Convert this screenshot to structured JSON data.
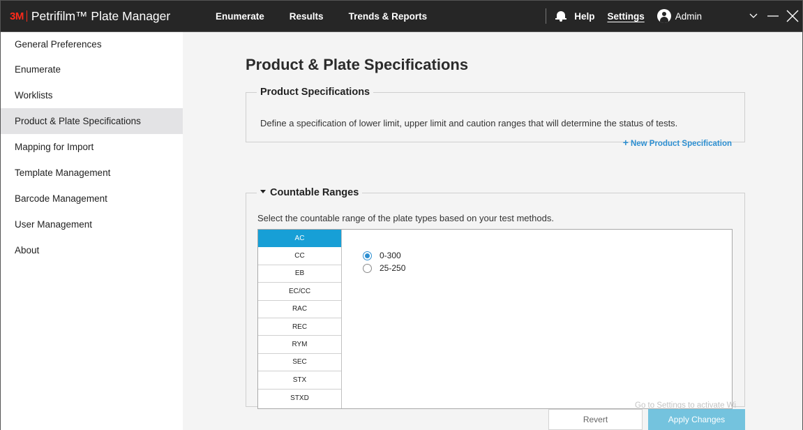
{
  "topbar": {
    "logo": "3M",
    "app_title": "Petrifilm™ Plate Manager",
    "nav": [
      "Enumerate",
      "Results",
      "Trends & Reports"
    ],
    "help": "Help",
    "settings": "Settings",
    "user": "Admin",
    "icons": [
      "bell-icon",
      "avatar-icon",
      "chevron-down-icon",
      "minimize-icon",
      "close-icon"
    ]
  },
  "sidebar": {
    "items": [
      {
        "label": "General Preferences"
      },
      {
        "label": "Enumerate"
      },
      {
        "label": "Worklists"
      },
      {
        "label": "Product & Plate Specifications",
        "active": true
      },
      {
        "label": "Mapping for Import"
      },
      {
        "label": "Template Management"
      },
      {
        "label": "Barcode Management"
      },
      {
        "label": "User Management"
      },
      {
        "label": "About"
      }
    ]
  },
  "main": {
    "title": "Product & Plate Specifications",
    "product_specs": {
      "legend": "Product Specifications",
      "description": "Define a specification of lower limit, upper limit and caution ranges that will determine the status of tests.",
      "new_link": "New Product Specification"
    },
    "countable_ranges": {
      "legend": "Countable Ranges",
      "description": "Select the countable range of the plate types based on your test methods.",
      "plate_types": [
        "AC",
        "CC",
        "EB",
        "EC/CC",
        "RAC",
        "REC",
        "RYM",
        "SEC",
        "STX",
        "STXD"
      ],
      "selected_plate": "AC",
      "ranges": [
        {
          "label": "0-300",
          "checked": true
        },
        {
          "label": "25-250",
          "checked": false
        }
      ]
    },
    "watermark": "Go to Settings to activate Wi",
    "buttons": {
      "revert": "Revert",
      "apply": "Apply Changes"
    }
  },
  "colors": {
    "topbar_bg": "#262626",
    "accent_blue": "#179fd6",
    "link_blue": "#2d8fd1",
    "brand_red": "#ff2a1a"
  }
}
